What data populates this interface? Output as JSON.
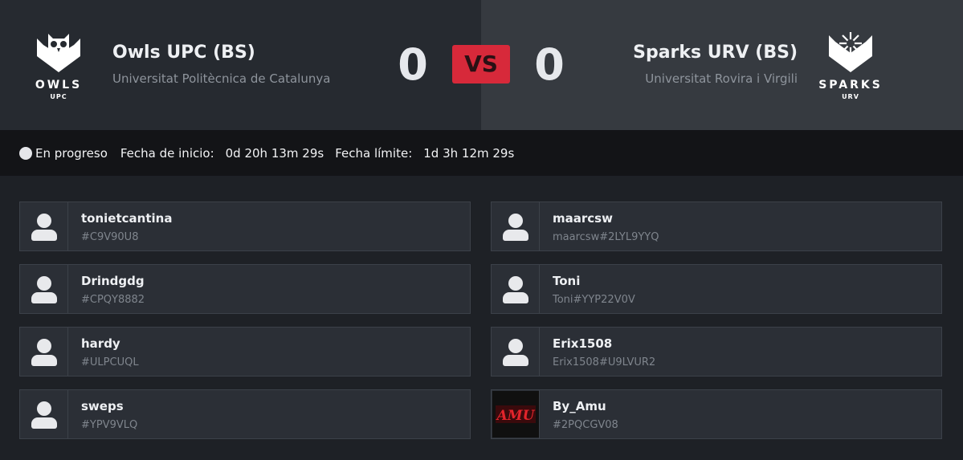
{
  "match": {
    "home": {
      "name": "Owls UPC (BS)",
      "university": "Universitat Politècnica de Catalunya",
      "logo_text": "OWLS",
      "logo_sub": "UPC",
      "score": "0"
    },
    "vs_label": "VS",
    "away": {
      "name": "Sparks URV (BS)",
      "university": "Universitat Rovira i Virgili",
      "logo_text": "SPARKS",
      "logo_sub": "URV",
      "score": "0"
    }
  },
  "status": {
    "state": "En progreso",
    "start_label": "Fecha de inicio:",
    "start_value": "0d 20h 13m 29s",
    "deadline_label": "Fecha límite:",
    "deadline_value": "1d 3h 12m 29s"
  },
  "home_players": [
    {
      "name": "tonietcantina",
      "tag": "#C9V90U8",
      "avatar": "user-icon"
    },
    {
      "name": "Drindgdg",
      "tag": "#CPQY8882",
      "avatar": "user-icon"
    },
    {
      "name": "hardy",
      "tag": "#ULPCUQL",
      "avatar": "user-icon"
    },
    {
      "name": "sweps",
      "tag": "#YPV9VLQ",
      "avatar": "user-icon"
    }
  ],
  "away_players": [
    {
      "name": "maarcsw",
      "tag": "maarcsw#2LYL9YYQ",
      "avatar": "user-icon"
    },
    {
      "name": "Toni",
      "tag": "Toni#YYP22V0V",
      "avatar": "user-icon"
    },
    {
      "name": "Erix1508",
      "tag": "Erix1508#U9LVUR2",
      "avatar": "user-icon"
    },
    {
      "name": "By_Amu",
      "tag": "#2PQCGV08",
      "avatar": "custom-avatar",
      "avatar_text": "AMU"
    }
  ],
  "colors": {
    "vs_badge": "#d7293a",
    "header_left": "#262a30",
    "header_right": "#363a40",
    "status_bar": "#131417",
    "card": "#2b2f36"
  }
}
